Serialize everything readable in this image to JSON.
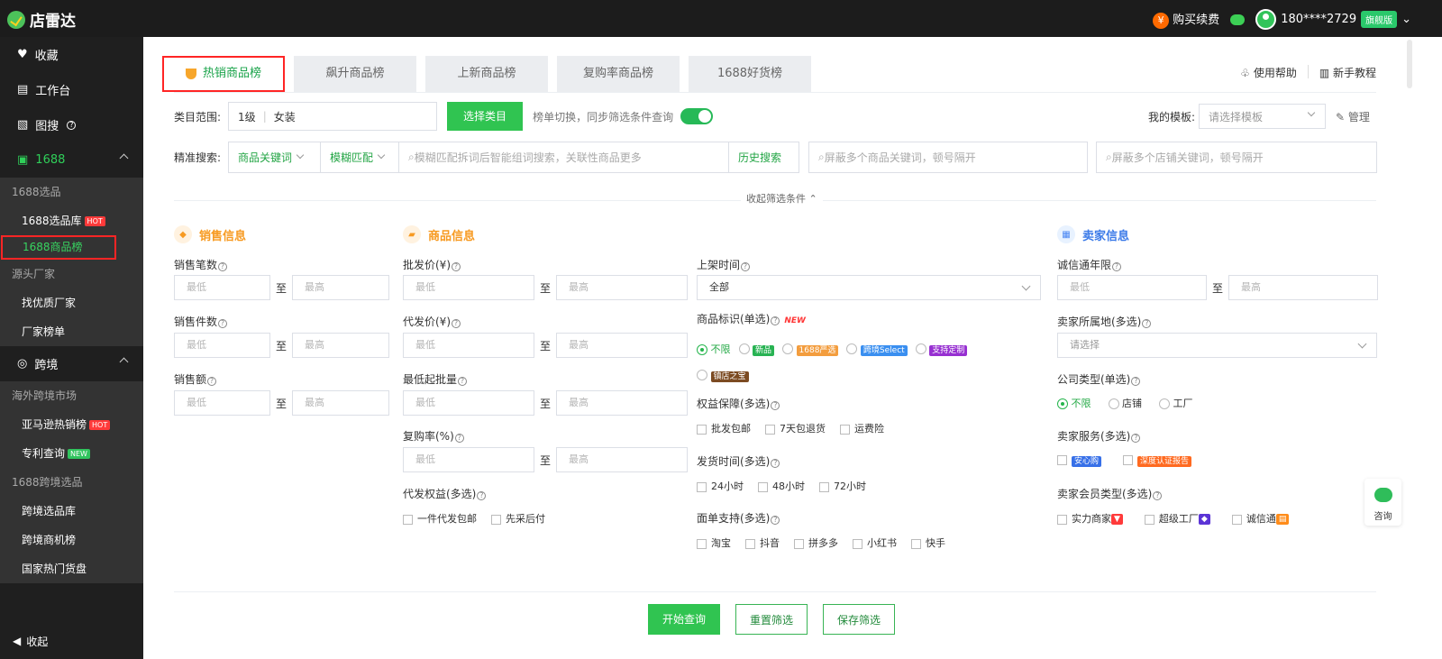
{
  "app": {
    "title": "店雷达"
  },
  "top": {
    "buy": "购买续费",
    "phone": "180****2729",
    "edition": "旗舰版"
  },
  "sidebar": {
    "favorites": "收藏",
    "workbench": "工作台",
    "image_search": "图搜",
    "group_1688": "1688",
    "sub_1688_select": "1688选品",
    "library": "1688选品库",
    "hot": "HOT",
    "ranking": "1688商品榜",
    "source_factory": "源头厂家",
    "find_factory": "找优质厂家",
    "factory_rank": "厂家榜单",
    "crossborder": "跨境",
    "overseas": "海外跨境市场",
    "amazon": "亚马逊热销榜",
    "patent": "专利查询",
    "new": "NEW",
    "cross_select": "1688跨境选品",
    "cross_library": "跨境选品库",
    "cross_opportunity": "跨境商机榜",
    "country_hot": "国家热门货盘",
    "collapse": "收起"
  },
  "tabs": [
    {
      "label": "热销商品榜"
    },
    {
      "label": "飙升商品榜"
    },
    {
      "label": "上新商品榜"
    },
    {
      "label": "复购率商品榜"
    },
    {
      "label": "1688好货榜"
    }
  ],
  "help": {
    "usage": "使用帮助",
    "tutorial": "新手教程"
  },
  "category": {
    "label": "类目范围:",
    "level": "1级",
    "value": "女装",
    "choose": "选择类目",
    "sync_text": "榜单切换，同步筛选条件查询",
    "template_label": "我的模板:",
    "template_placeholder": "请选择模板",
    "manage": "管理"
  },
  "search": {
    "label": "精准搜索:",
    "keyword_type": "商品关键词",
    "match_type": "模糊匹配",
    "placeholder": "模糊匹配拆词后智能组词搜索，关联性商品更多",
    "history": "历史搜索",
    "block_goods": "屏蔽多个商品关键词，顿号隔开",
    "block_shop": "屏蔽多个店铺关键词，顿号隔开",
    "collapse": "收起筛选条件"
  },
  "sections": {
    "sales": "销售信息",
    "goods": "商品信息",
    "seller": "卖家信息"
  },
  "fields": {
    "sales_count": "销售笔数",
    "sales_items": "销售件数",
    "sales_amount": "销售额",
    "wholesale": "批发价(¥)",
    "dropship": "代发价(¥)",
    "min_batch": "最低起批量",
    "repurchase": "复购率(%)",
    "dropship_rights": "代发权益(多选)",
    "one_piece": "一件代发包邮",
    "first_use": "先采后付",
    "listing_time": "上架时间",
    "all": "全部",
    "product_mark": "商品标识(单选)",
    "new_label": "NEW",
    "unlimited": "不限",
    "new_item": "新品",
    "strict": "1688严选",
    "cross_select": "跨境Select",
    "custom": "支持定制",
    "shop_treasure": "镇店之宝",
    "rights": "权益保障(多选)",
    "wholesale_free": "批发包邮",
    "seven_days": "7天包退货",
    "freight": "运费险",
    "ship_time": "发货时间(多选)",
    "h24": "24小时",
    "h48": "48小时",
    "h72": "72小时",
    "waybill": "面单支持(多选)",
    "taobao": "淘宝",
    "douyin": "抖音",
    "pdd": "拼多多",
    "xhs": "小红书",
    "kuaishou": "快手",
    "trust_years": "诚信通年限",
    "location": "卖家所属地(多选)",
    "please_select": "请选择",
    "company_type": "公司类型(单选)",
    "store": "店铺",
    "factory": "工厂",
    "seller_service": "卖家服务(多选)",
    "anxin": "安心购",
    "depth_report": "深度认证报告",
    "member_type": "卖家会员类型(多选)",
    "power": "实力商家",
    "super_factory": "超级工厂",
    "trust": "诚信通",
    "min": "最低",
    "max": "最高",
    "to": "至"
  },
  "actions": {
    "start": "开始查询",
    "reset": "重置筛选",
    "save": "保存筛选"
  },
  "consult": "咨询"
}
